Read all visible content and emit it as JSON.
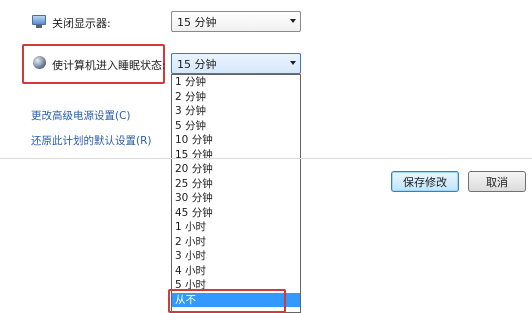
{
  "settings": {
    "display_off": {
      "label": "关闭显示器:",
      "value": "15 分钟"
    },
    "sleep": {
      "label": "使计算机进入睡眠状态:",
      "value": "15 分钟"
    }
  },
  "dropdown": {
    "options": [
      "1 分钟",
      "2 分钟",
      "3 分钟",
      "5 分钟",
      "10 分钟",
      "15 分钟",
      "20 分钟",
      "25 分钟",
      "30 分钟",
      "45 分钟",
      "1 小时",
      "2 小时",
      "3 小时",
      "4 小时",
      "5 小时",
      "从不"
    ],
    "highlighted_option": "从不"
  },
  "links": {
    "advanced": "更改高级电源设置(C)",
    "restore": "还原此计划的默认设置(R)"
  },
  "buttons": {
    "save": "保存修改",
    "cancel": "取消"
  },
  "colors": {
    "annotation_box": "#d03a3a",
    "selection": "#3399ff",
    "link": "#2a5ea8"
  }
}
